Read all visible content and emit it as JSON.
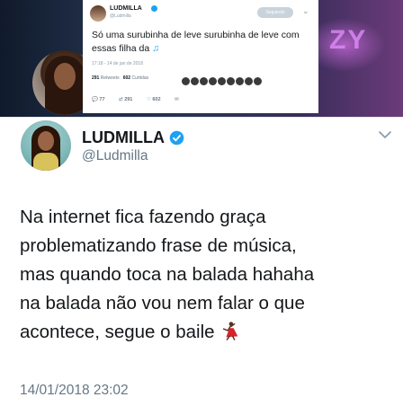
{
  "embedded_tweet": {
    "name": "LUDMILLA",
    "handle": "@Ludmilla",
    "follow_label": "Seguindo",
    "text": "Só uma surubinha de leve surubinha de leve com essas filha da",
    "date": "17:18 - 14 de jan de 2018",
    "retweets": "291",
    "retweets_label": "Retweets",
    "likes": "602",
    "likes_label": "Curtidas",
    "reply_count": "77",
    "retweet_count": "291",
    "like_count": "602",
    "background_text": "ZY"
  },
  "tweet": {
    "name": "LUDMILLA",
    "handle": "@Ludmilla",
    "lines": [
      "Na internet fica fazendo graça",
      "problematizando frase de música,",
      "mas quando toca na balada hahaha",
      "na balada não vou nem falar o que",
      "acontece, segue o baile"
    ],
    "timestamp": "14/01/2018 23:02"
  },
  "colors": {
    "verified": "#1da1f2",
    "text": "#14171a",
    "secondary": "#657786"
  },
  "icons": {
    "verified": "verified-badge-icon",
    "chevron": "chevron-down-icon",
    "dancer": "dancer-emoji-icon",
    "music": "music-note-icon"
  }
}
